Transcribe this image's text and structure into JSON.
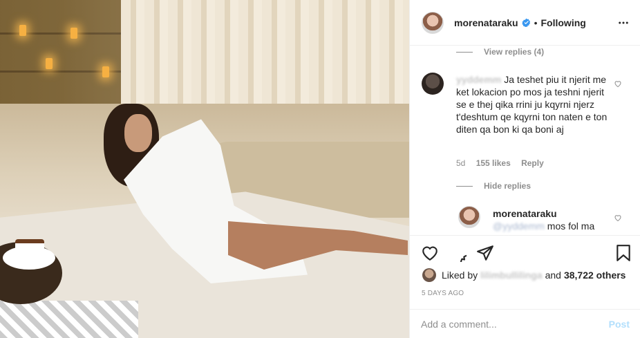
{
  "post": {
    "username": "morenataraku",
    "verified_icon": "verified-badge-icon",
    "separator": "•",
    "follow_status": "Following",
    "more_icon": "more-options-icon"
  },
  "comments": {
    "view_replies": "View replies (4)",
    "comment": {
      "username": "yyddemm",
      "text": "Ja teshet piu  it njerit me ket lokacion po mos ja teshni njerit se e thej qika rrini ju kqyrni njerz t'deshtum qe kqyrni ton naten e ton diten qa bon ki qa boni aj",
      "age": "5d",
      "likes": "155 likes",
      "reply": "Reply"
    },
    "hide_replies": "Hide replies",
    "reply": {
      "username": "morenataraku",
      "mention": "@yyddemm",
      "text": "mos fol ma"
    }
  },
  "actions": {
    "like_icon": "heart-icon",
    "comment_icon": "comment-icon",
    "share_icon": "share-icon",
    "save_icon": "bookmark-icon"
  },
  "likes": {
    "prefix": "Liked by",
    "user": "lilimbullilinga",
    "conjunction": "and",
    "others": "38,722 others"
  },
  "date": "5 DAYS AGO",
  "add_comment": {
    "placeholder": "Add a comment...",
    "post_label": "Post"
  },
  "colors": {
    "link_blue": "#0095f6",
    "post_disabled": "#b2dffc",
    "muted": "#8e8e8e",
    "border": "#efefef"
  }
}
